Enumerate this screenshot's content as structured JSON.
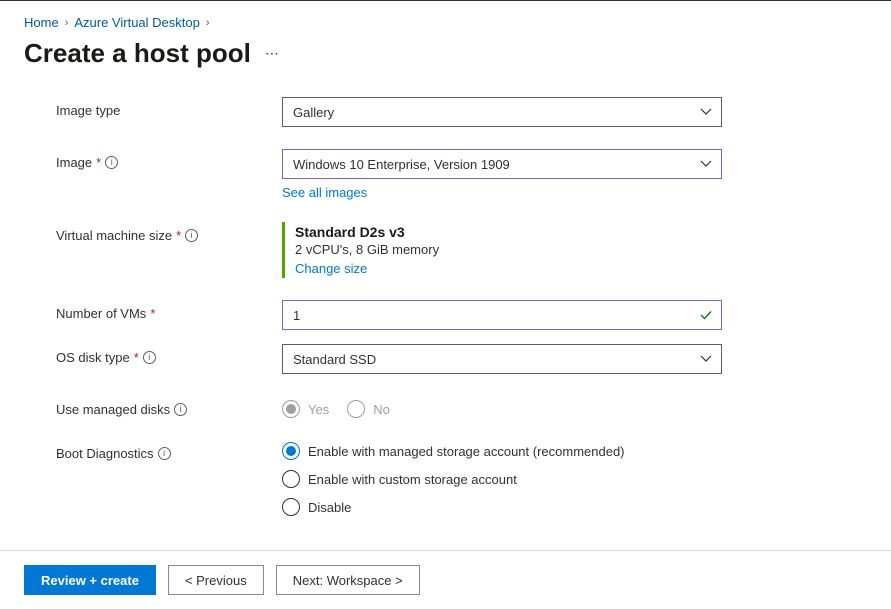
{
  "breadcrumb": {
    "items": [
      "Home",
      "Azure Virtual Desktop"
    ]
  },
  "title": "Create a host pool",
  "form": {
    "image_type": {
      "label": "Image type",
      "value": "Gallery"
    },
    "image": {
      "label": "Image",
      "value": "Windows 10 Enterprise, Version 1909",
      "link": "See all images"
    },
    "vm_size": {
      "label": "Virtual machine size",
      "name": "Standard D2s v3",
      "specs": "2 vCPU's, 8 GiB memory",
      "link": "Change size"
    },
    "num_vms": {
      "label": "Number of VMs",
      "value": "1"
    },
    "os_disk": {
      "label": "OS disk type",
      "value": "Standard SSD"
    },
    "managed_disks": {
      "label": "Use managed disks",
      "options": [
        "Yes",
        "No"
      ],
      "selected": "Yes"
    },
    "boot_diag": {
      "label": "Boot Diagnostics",
      "options": [
        "Enable with managed storage account (recommended)",
        "Enable with custom storage account",
        "Disable"
      ],
      "selected": "Enable with managed storage account (recommended)"
    }
  },
  "footer": {
    "primary": "Review + create",
    "prev": "< Previous",
    "next": "Next: Workspace >"
  }
}
